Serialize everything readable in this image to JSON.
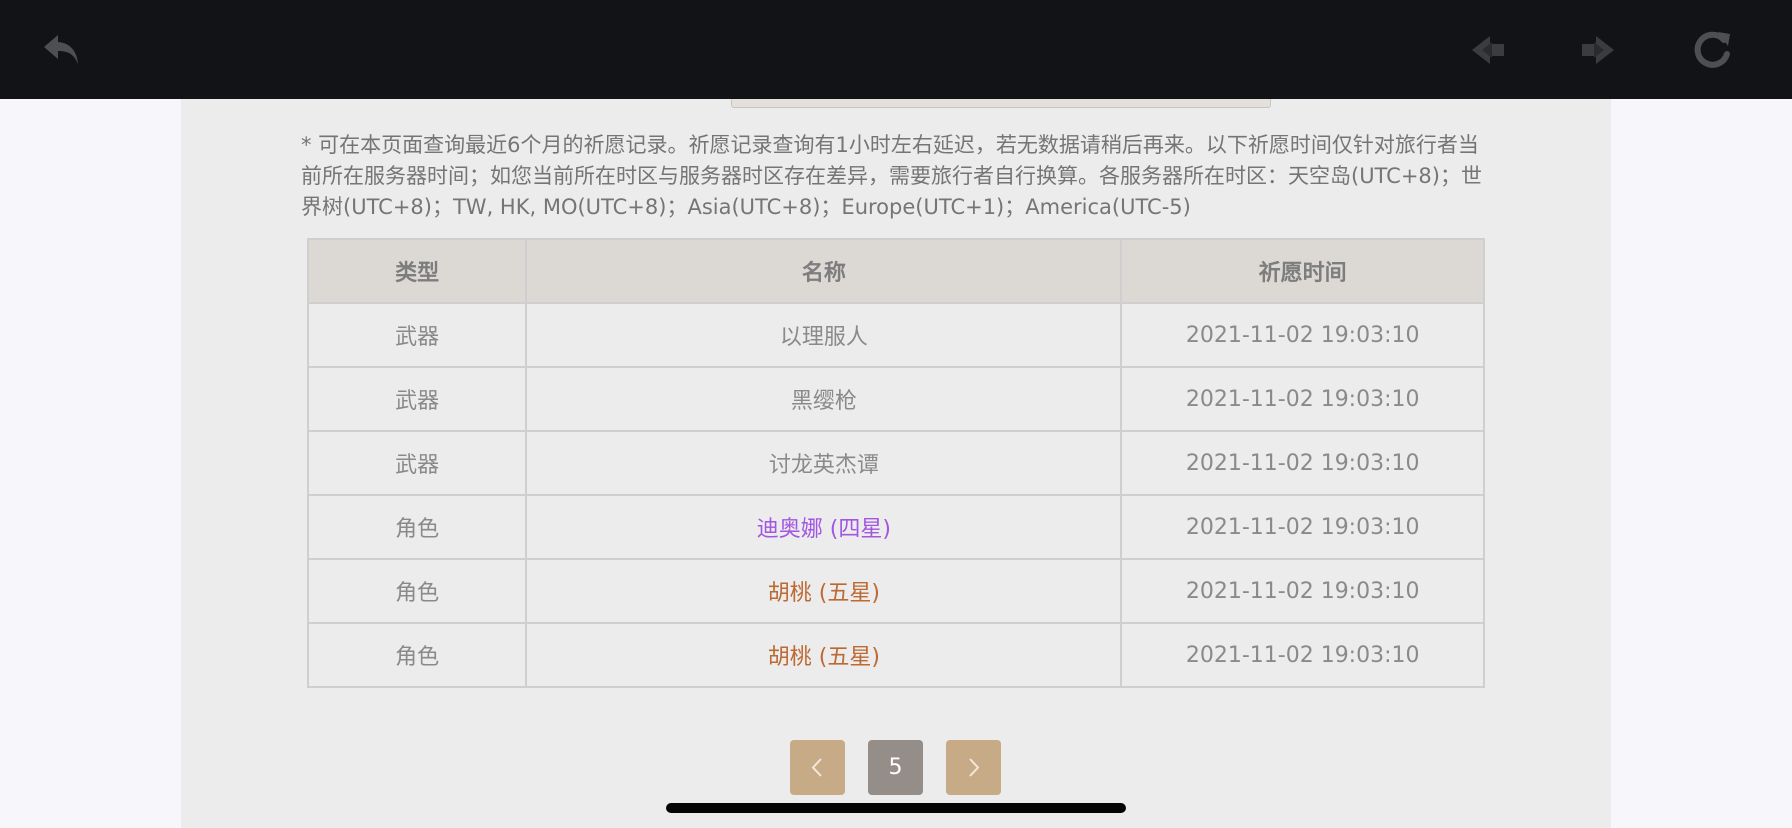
{
  "toolbar": {
    "back_icon": "undo-arrow-icon",
    "prev_icon": "arrow-left-icon",
    "next_icon": "arrow-right-icon",
    "reload_icon": "reload-icon",
    "background": "#121317"
  },
  "notice": "* 可在本页面查询最近6个月的祈愿记录。祈愿记录查询有1小时左右延迟，若无数据请稍后再来。以下祈愿时间仅针对旅行者当前所在服务器时间；如您当前所在时区与服务器时区存在差异，需要旅行者自行换算。各服务器所在时区：天空岛(UTC+8)；世界树(UTC+8)；TW, HK, MO(UTC+8)；Asia(UTC+8)；Europe(UTC+1)；America(UTC-5)",
  "table": {
    "headers": [
      "类型",
      "名称",
      "祈愿时间"
    ],
    "rows": [
      {
        "type": "武器",
        "name": "以理服人",
        "time": "2021-11-02 19:03:10",
        "color": "#8a8a8a"
      },
      {
        "type": "武器",
        "name": "黑缨枪",
        "time": "2021-11-02 19:03:10",
        "color": "#8a8a8a"
      },
      {
        "type": "武器",
        "name": "讨龙英杰谭",
        "time": "2021-11-02 19:03:10",
        "color": "#8a8a8a"
      },
      {
        "type": "角色",
        "name": "迪奥娜 (四星)",
        "time": "2021-11-02 19:03:10",
        "color": "#a256e1"
      },
      {
        "type": "角色",
        "name": "胡桃 (五星)",
        "time": "2021-11-02 19:03:10",
        "color": "#bd6932"
      },
      {
        "type": "角色",
        "name": "胡桃 (五星)",
        "time": "2021-11-02 19:03:10",
        "color": "#bd6932"
      }
    ]
  },
  "pagination": {
    "current_page": "5",
    "prev_icon": "chevron-left-icon",
    "next_icon": "chevron-right-icon",
    "accent": "#c7aa86",
    "active_color": "#958d87"
  }
}
